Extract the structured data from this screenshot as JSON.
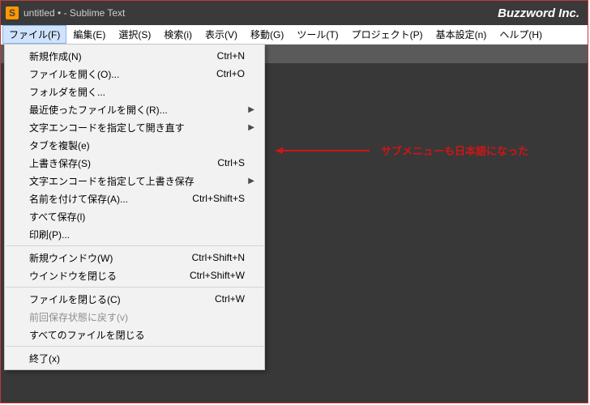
{
  "title_bar": {
    "app_icon_letter": "S",
    "title": "untitled • - Sublime Text",
    "brand": "Buzzword Inc."
  },
  "menu_bar": {
    "items": [
      "ファイル(F)",
      "編集(E)",
      "選択(S)",
      "検索(i)",
      "表示(V)",
      "移動(G)",
      "ツール(T)",
      "プロジェクト(P)",
      "基本設定(n)",
      "ヘルプ(H)"
    ],
    "active_index": 0
  },
  "dropdown": {
    "groups": [
      [
        {
          "label": "新規作成(N)",
          "shortcut": "Ctrl+N",
          "submenu": false,
          "disabled": false
        },
        {
          "label": "ファイルを開く(O)...",
          "shortcut": "Ctrl+O",
          "submenu": false,
          "disabled": false
        },
        {
          "label": "フォルダを開く...",
          "shortcut": "",
          "submenu": false,
          "disabled": false
        },
        {
          "label": "最近使ったファイルを開く(R)...",
          "shortcut": "",
          "submenu": true,
          "disabled": false
        },
        {
          "label": "文字エンコードを指定して開き直す",
          "shortcut": "",
          "submenu": true,
          "disabled": false
        },
        {
          "label": "タブを複製(e)",
          "shortcut": "",
          "submenu": false,
          "disabled": false
        },
        {
          "label": "上書き保存(S)",
          "shortcut": "Ctrl+S",
          "submenu": false,
          "disabled": false
        },
        {
          "label": "文字エンコードを指定して上書き保存",
          "shortcut": "",
          "submenu": true,
          "disabled": false
        },
        {
          "label": "名前を付けて保存(A)...",
          "shortcut": "Ctrl+Shift+S",
          "submenu": false,
          "disabled": false
        },
        {
          "label": "すべて保存(l)",
          "shortcut": "",
          "submenu": false,
          "disabled": false
        },
        {
          "label": "印刷(P)...",
          "shortcut": "",
          "submenu": false,
          "disabled": false
        }
      ],
      [
        {
          "label": "新規ウインドウ(W)",
          "shortcut": "Ctrl+Shift+N",
          "submenu": false,
          "disabled": false
        },
        {
          "label": "ウインドウを閉じる",
          "shortcut": "Ctrl+Shift+W",
          "submenu": false,
          "disabled": false
        }
      ],
      [
        {
          "label": "ファイルを閉じる(C)",
          "shortcut": "Ctrl+W",
          "submenu": false,
          "disabled": false
        },
        {
          "label": "前回保存状態に戻す(v)",
          "shortcut": "",
          "submenu": false,
          "disabled": true
        },
        {
          "label": "すべてのファイルを閉じる",
          "shortcut": "",
          "submenu": false,
          "disabled": false
        }
      ],
      [
        {
          "label": "終了(x)",
          "shortcut": "",
          "submenu": false,
          "disabled": false
        }
      ]
    ]
  },
  "annotation": {
    "text": "サブメニューも日本語になった"
  }
}
